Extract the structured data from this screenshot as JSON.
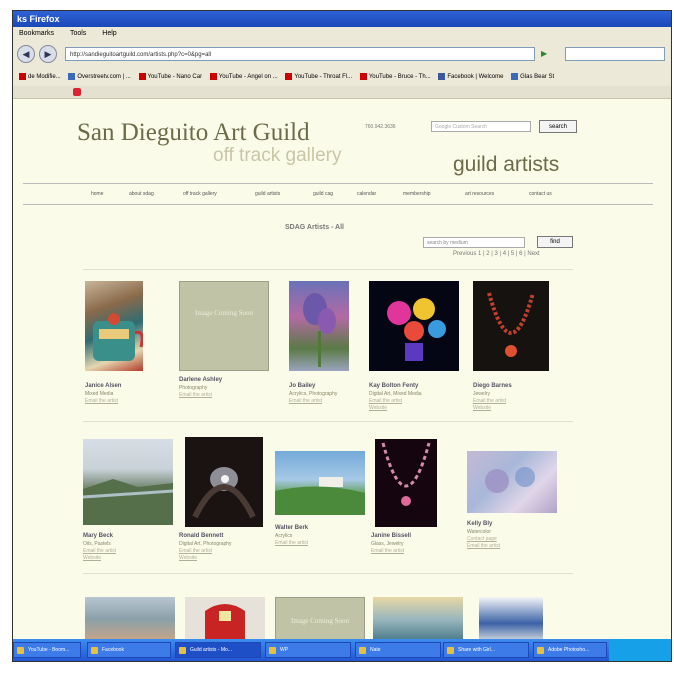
{
  "window": {
    "title": "ks Firefox"
  },
  "menu": [
    "Bookmarks",
    "Tools",
    "Help"
  ],
  "nav": {
    "back": "◀",
    "forward": "▶",
    "address": "http://sandieguitoartguild.com/artists.php?c=0&pg=all",
    "go": "▶"
  },
  "bookmarks": [
    "de Modifie...",
    "Overstreetv.com | ...",
    "YouTube - Nano Car",
    "YouTube - Angel on ...",
    "YouTube - Throat Fl...",
    "YouTube - Bruce - Th...",
    "Facebook | Welcome",
    "Glas Bear St"
  ],
  "site": {
    "title": "San Dieguito Art Guild",
    "subtitle": "off track gallery",
    "phone": "760.942.3636",
    "search_placeholder": "Google Custom Search",
    "search_button": "search",
    "section": "guild artists",
    "navlinks": [
      "home",
      "about sdag",
      "off track gallery",
      "guild artists",
      "guild cag",
      "calendar",
      "membership",
      "art resources",
      "contact us"
    ],
    "subhead": "SDAG Artists - All",
    "select_text": "search by medium",
    "find_button": "find",
    "pager": "Previous 1 | 2 | 3 | 4 | 5 | 6 | Next"
  },
  "artists_row1": [
    {
      "name": "Janice Alsen",
      "meta": "Mixed Media",
      "link": "Email the artist"
    },
    {
      "name": "Darlene Ashley",
      "meta": "Photography",
      "link": "Email the artist"
    },
    {
      "name": "Jo Bailey",
      "meta": "Acrylics, Photography",
      "link": "Email the artist"
    },
    {
      "name": "Kay Bolton Fenty",
      "meta": "Digital Art, Mixed Media",
      "link": "Email the artist",
      "link2": "Website"
    },
    {
      "name": "Diego Barnes",
      "meta": "Jewelry",
      "link": "Email the artist",
      "link2": "Website"
    }
  ],
  "artists_row2": [
    {
      "name": "Mary Beck",
      "meta": "Oils, Pastels",
      "link": "Email the artist",
      "link2": "Website"
    },
    {
      "name": "Ronald Bennett",
      "meta": "Digital Art, Photography",
      "link": "Email the artist",
      "link2": "Website"
    },
    {
      "name": "Walter Berk",
      "meta": "Acrylics",
      "link": "Email the artist"
    },
    {
      "name": "Janine Bissell",
      "meta": "Glass, Jewelry",
      "link": "Email the artist"
    },
    {
      "name": "Kelly Bly",
      "meta": "Watercolor",
      "link": "Contact page",
      "link2": "Email the artist"
    }
  ],
  "placeholder_text": "Image Coming Soon",
  "taskbar": [
    "YouTube - Boom...",
    "Facebook",
    "Guild artists - Mo...",
    "WP",
    "Nate",
    "Share with Girl...",
    "Adobe Photosho..."
  ],
  "colors": {
    "page_bg": "#fbfbe9",
    "title": "#6b6b4a",
    "subtitle": "#c8c6a6",
    "taskbar": "#2e6be0"
  }
}
